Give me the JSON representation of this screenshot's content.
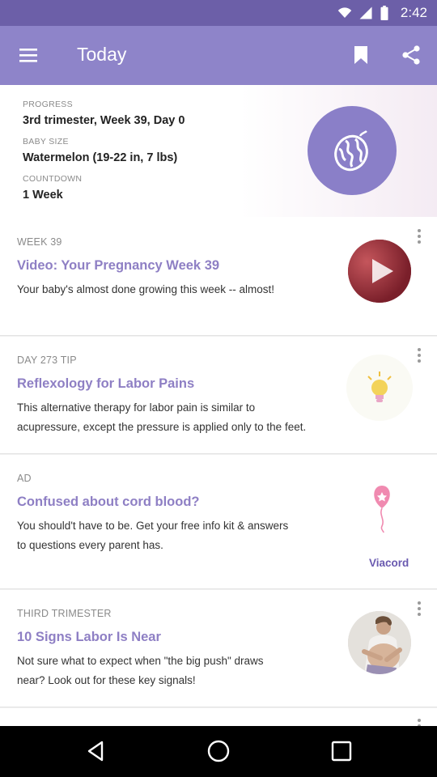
{
  "status_bar": {
    "time": "2:42"
  },
  "app_bar": {
    "title": "Today"
  },
  "progress": {
    "progress_label": "PROGRESS",
    "progress_value": "3rd trimester, Week 39, Day 0",
    "baby_size_label": "BABY SIZE",
    "baby_size_value": "Watermelon (19-22 in, 7 lbs)",
    "countdown_label": "COUNTDOWN",
    "countdown_value": "1 Week",
    "fruit_icon": "watermelon-icon"
  },
  "feed": [
    {
      "kicker": "WEEK 39",
      "headline": "Video: Your Pregnancy Week 39",
      "body": "Your baby's almost done growing this week -- almost!",
      "thumb_icon": "play-icon"
    },
    {
      "kicker": "DAY 273 TIP",
      "headline": "Reflexology for Labor Pains",
      "body_line1": "This alternative therapy for labor pain is similar to",
      "body_line2": "acupressure, except the pressure is applied only to the feet.",
      "thumb_icon": "lightbulb-icon"
    },
    {
      "kicker": "AD",
      "headline": "Confused about cord blood?",
      "body_line1": "You should't have to be. Get your free info kit & answers",
      "body_line2": "to questions every parent has.",
      "sponsor": "Viacord",
      "thumb_icon": "balloon-icon"
    },
    {
      "kicker": "THIRD TRIMESTER",
      "headline": "10 Signs Labor Is Near",
      "body_line1": "Not sure what to expect when \"the big push\" draws",
      "body_line2": "near? Look out for these key signals!",
      "thumb_icon": "pregnant-woman-photo"
    }
  ],
  "colors": {
    "status_bar": "#6c5fa8",
    "app_bar": "#8e84c9",
    "accent": "#8e7fc4",
    "sponsor": "#6a5ab0"
  }
}
